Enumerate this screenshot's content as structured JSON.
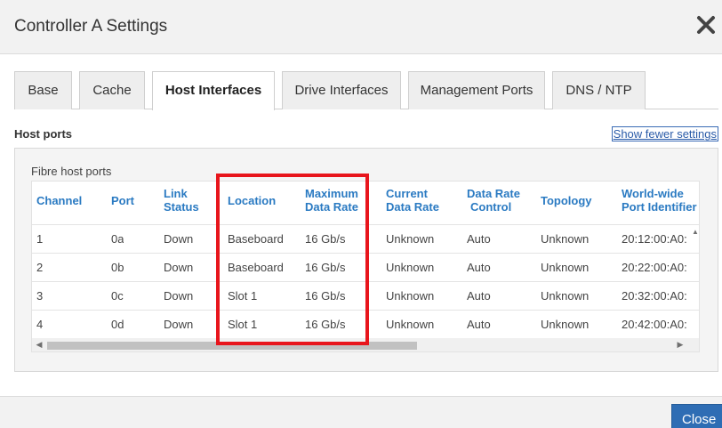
{
  "dialog": {
    "title": "Controller A Settings",
    "close_button": "Close"
  },
  "tabs": [
    {
      "label": "Base"
    },
    {
      "label": "Cache"
    },
    {
      "label": "Host Interfaces"
    },
    {
      "label": "Drive Interfaces"
    },
    {
      "label": "Management Ports"
    },
    {
      "label": "DNS / NTP"
    }
  ],
  "active_tab": "Host Interfaces",
  "section": {
    "title": "Host ports",
    "toggle_link": "Show fewer settings",
    "subtitle": "Fibre host ports"
  },
  "table": {
    "headers": [
      {
        "l1": "Channel",
        "l2": ""
      },
      {
        "l1": "Port",
        "l2": ""
      },
      {
        "l1": "Link",
        "l2": "Status"
      },
      {
        "l1": "Location",
        "l2": ""
      },
      {
        "l1": "Maximum",
        "l2": "Data Rate"
      },
      {
        "l1": "Current",
        "l2": "Data Rate"
      },
      {
        "l1": "Data Rate",
        "l2": "Control"
      },
      {
        "l1": "Topology",
        "l2": ""
      },
      {
        "l1": "World-wide",
        "l2": "Port Identifier"
      }
    ],
    "rows": [
      [
        "1",
        "0a",
        "Down",
        "Baseboard",
        "16 Gb/s",
        "Unknown",
        "Auto",
        "Unknown",
        "20:12:00:A0:"
      ],
      [
        "2",
        "0b",
        "Down",
        "Baseboard",
        "16 Gb/s",
        "Unknown",
        "Auto",
        "Unknown",
        "20:22:00:A0:"
      ],
      [
        "3",
        "0c",
        "Down",
        "Slot 1",
        "16 Gb/s",
        "Unknown",
        "Auto",
        "Unknown",
        "20:32:00:A0:"
      ],
      [
        "4",
        "0d",
        "Down",
        "Slot 1",
        "16 Gb/s",
        "Unknown",
        "Auto",
        "Unknown",
        "20:42:00:A0:"
      ]
    ]
  },
  "colors": {
    "accent": "#2a7ac2",
    "highlight": "#e8151c",
    "primary_button": "#2e6db4"
  }
}
